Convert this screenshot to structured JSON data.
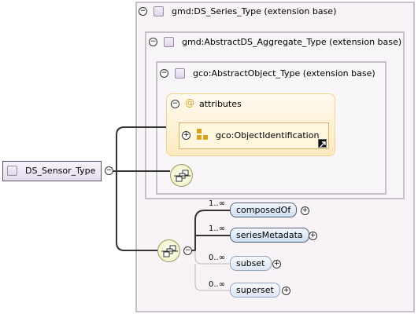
{
  "root": {
    "label": "DS_Sensor_Type"
  },
  "series_type": {
    "label": "gmd:DS_Series_Type (extension base)"
  },
  "aggregate_type": {
    "label": "gmd:AbstractDS_Aggregate_Type (extension base)"
  },
  "object_type": {
    "label": "gco:AbstractObject_Type (extension base)"
  },
  "attributes": {
    "label": "attributes",
    "at_symbol": "@",
    "item": "gco:ObjectIdentification"
  },
  "elements": [
    {
      "name": "composedOf",
      "multiplicity": "1..∞",
      "required": true
    },
    {
      "name": "seriesMetadata",
      "multiplicity": "1..∞",
      "required": true
    },
    {
      "name": "subset",
      "multiplicity": "0..∞",
      "required": false
    },
    {
      "name": "superset",
      "multiplicity": "0..∞",
      "required": false
    }
  ],
  "symbols": {
    "collapse": "⊖",
    "expand": "⊕"
  },
  "colors": {
    "panel_border": "#c8c0c8",
    "panel_bg": "#f7f3f7",
    "attr_bg": "#fde9c0",
    "element_bg": "#cfdcf0",
    "connector": "#333333"
  }
}
